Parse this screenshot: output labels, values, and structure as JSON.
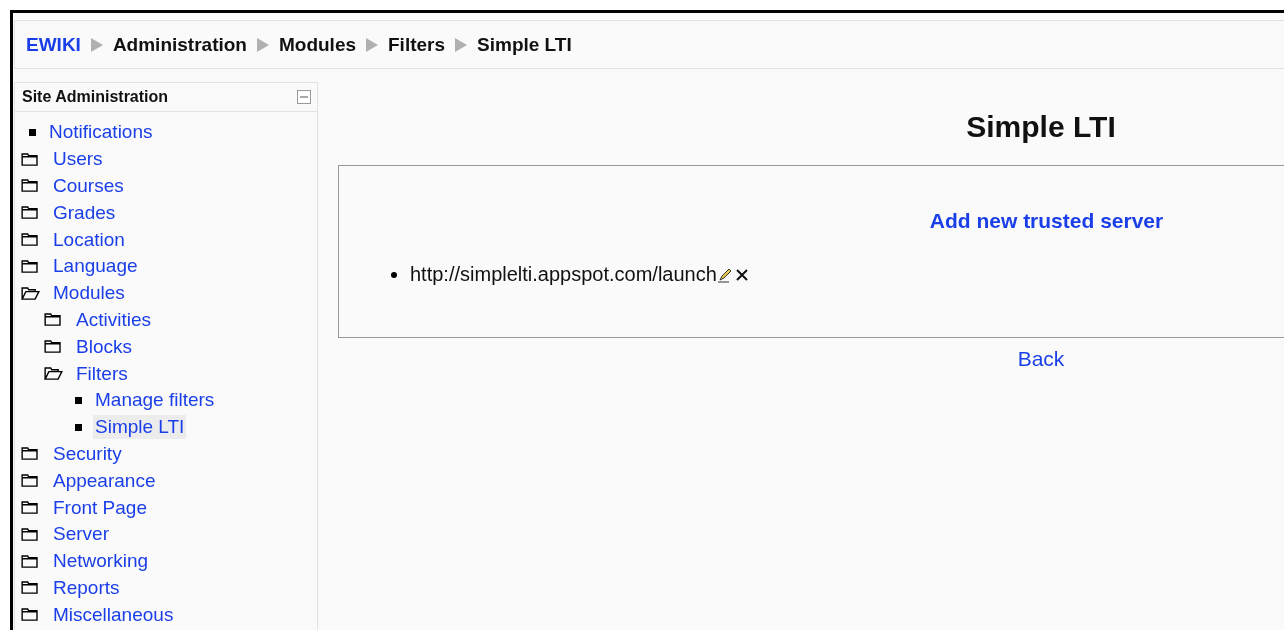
{
  "breadcrumb": [
    {
      "label": "EWIKI",
      "kind": "link"
    },
    {
      "label": "Administration",
      "kind": "current"
    },
    {
      "label": "Modules",
      "kind": "current"
    },
    {
      "label": "Filters",
      "kind": "current"
    },
    {
      "label": "Simple LTI",
      "kind": "current"
    }
  ],
  "sidebar": {
    "title": "Site Administration",
    "items": [
      {
        "label": "Notifications",
        "kind": "leaf",
        "selected": false
      },
      {
        "label": "Users",
        "kind": "folder",
        "expanded": false
      },
      {
        "label": "Courses",
        "kind": "folder",
        "expanded": false
      },
      {
        "label": "Grades",
        "kind": "folder",
        "expanded": false
      },
      {
        "label": "Location",
        "kind": "folder",
        "expanded": false
      },
      {
        "label": "Language",
        "kind": "folder",
        "expanded": false
      },
      {
        "label": "Modules",
        "kind": "folder",
        "expanded": true,
        "children": [
          {
            "label": "Activities",
            "kind": "folder",
            "expanded": false
          },
          {
            "label": "Blocks",
            "kind": "folder",
            "expanded": false
          },
          {
            "label": "Filters",
            "kind": "folder",
            "expanded": true,
            "children": [
              {
                "label": "Manage filters",
                "kind": "leaf",
                "selected": false
              },
              {
                "label": "Simple LTI",
                "kind": "leaf",
                "selected": true
              }
            ]
          }
        ]
      },
      {
        "label": "Security",
        "kind": "folder",
        "expanded": false
      },
      {
        "label": "Appearance",
        "kind": "folder",
        "expanded": false
      },
      {
        "label": "Front Page",
        "kind": "folder",
        "expanded": false
      },
      {
        "label": "Server",
        "kind": "folder",
        "expanded": false
      },
      {
        "label": "Networking",
        "kind": "folder",
        "expanded": false
      },
      {
        "label": "Reports",
        "kind": "folder",
        "expanded": false
      },
      {
        "label": "Miscellaneous",
        "kind": "folder",
        "expanded": false
      }
    ]
  },
  "page": {
    "title": "Simple LTI",
    "add_link": "Add new trusted server",
    "servers": [
      "http://simplelti.appspot.com/launch"
    ],
    "back_link": "Back"
  }
}
